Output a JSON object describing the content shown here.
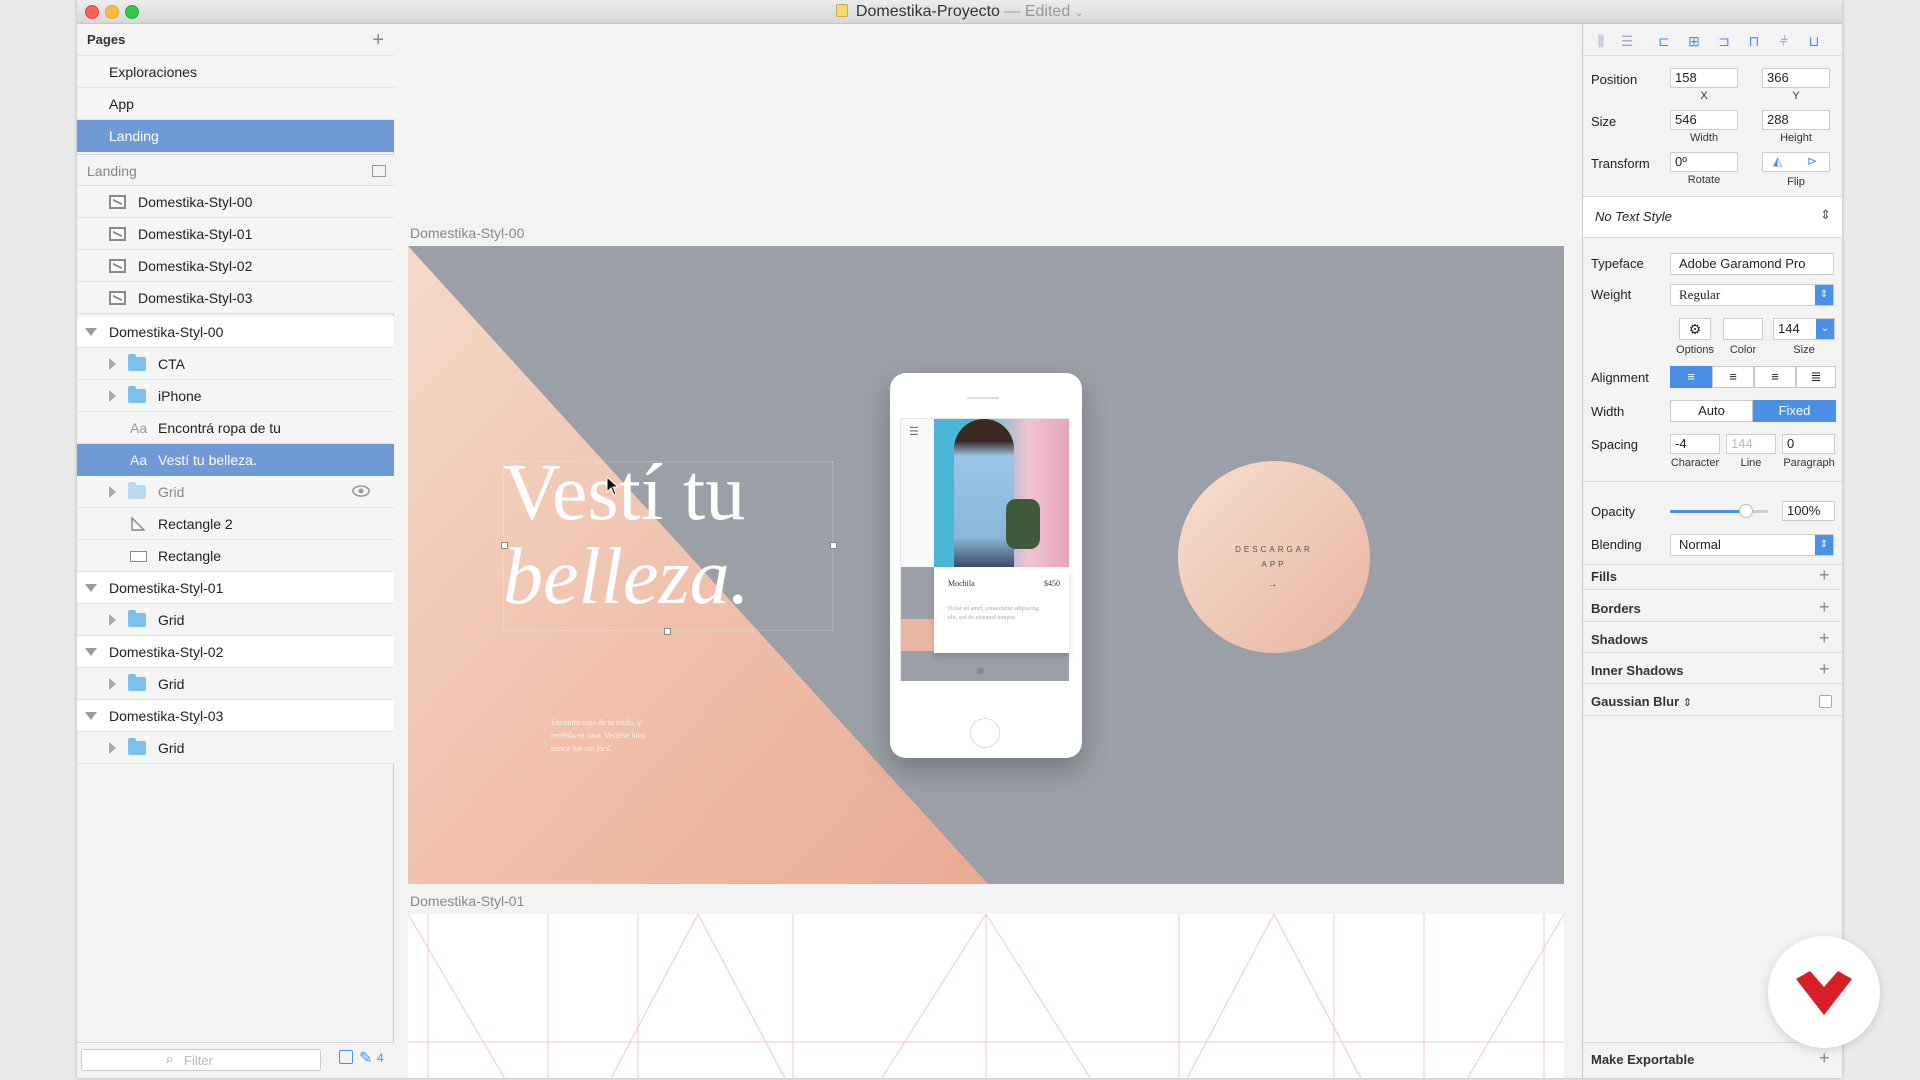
{
  "window": {
    "title": "Domestika-Proyecto",
    "title_separator": "—",
    "status": "Edited"
  },
  "pages": {
    "header": "Pages",
    "items": [
      "Exploraciones",
      "App",
      "Landing"
    ],
    "selected": "Landing"
  },
  "layers": {
    "header": "Landing",
    "artboards": [
      "Domestika-Styl-00",
      "Domestika-Styl-01",
      "Domestika-Styl-02",
      "Domestika-Styl-03"
    ],
    "tree": [
      {
        "label": "Domestika-Styl-00",
        "kind": "group"
      },
      {
        "label": "CTA",
        "kind": "folder"
      },
      {
        "label": "iPhone",
        "kind": "folder"
      },
      {
        "label": "Encontrá ropa de tu",
        "kind": "text",
        "icon_text": "Aa"
      },
      {
        "label": "Vestí tu belleza.",
        "kind": "text",
        "icon_text": "Aa",
        "selected": true
      },
      {
        "label": "Grid",
        "kind": "folder",
        "hidden": true
      },
      {
        "label": "Rectangle 2",
        "kind": "shape"
      },
      {
        "label": "Rectangle",
        "kind": "shape"
      },
      {
        "label": "Domestika-Styl-01",
        "kind": "group"
      },
      {
        "label": "Grid",
        "kind": "folder"
      },
      {
        "label": "Domestika-Styl-02",
        "kind": "group"
      },
      {
        "label": "Grid",
        "kind": "folder"
      },
      {
        "label": "Domestika-Styl-03",
        "kind": "group"
      },
      {
        "label": "Grid",
        "kind": "folder"
      }
    ],
    "filter_placeholder": "Filter",
    "footer_count": "4"
  },
  "canvas": {
    "artboard0_label": "Domestika-Styl-00",
    "artboard1_label": "Domestika-Styl-01",
    "headline_line1": "Vestí tu",
    "headline_line2": "belleza.",
    "body_text": "Encontrá ropa de tu estilo, y recibila en casa. Vestirse bien nunca fue tan fácil.",
    "phone": {
      "product_name": "Mochila",
      "product_price": "$450",
      "product_desc": "Dolor sit amet, consectetur adipiscing elit, sed do eiusmod tempor."
    },
    "cta_line1": "DESCARGAR",
    "cta_line2": "APP",
    "cta_arrow": "→"
  },
  "inspector": {
    "position_label": "Position",
    "x": "158",
    "y": "366",
    "x_label": "X",
    "y_label": "Y",
    "size_label": "Size",
    "width": "546",
    "height": "288",
    "width_label": "Width",
    "height_label": "Height",
    "transform_label": "Transform",
    "rotate": "0º",
    "rotate_label": "Rotate",
    "flip_label": "Flip",
    "text_style": "No Text Style",
    "typeface_label": "Typeface",
    "typeface": "Adobe Garamond Pro",
    "weight_label": "Weight",
    "weight": "Regular",
    "options_label": "Options",
    "color_label": "Color",
    "size_value": "144",
    "size_sub_label": "Size",
    "alignment_label": "Alignment",
    "width_mode_label": "Width",
    "width_auto": "Auto",
    "width_fixed": "Fixed",
    "spacing_label": "Spacing",
    "character": "-4",
    "line": "144",
    "paragraph": "0",
    "character_label": "Character",
    "line_label": "Line",
    "paragraph_label": "Paragraph",
    "opacity_label": "Opacity",
    "opacity": "100%",
    "opacity_fraction": 1.0,
    "blending_label": "Blending",
    "blending": "Normal",
    "sections": [
      "Fills",
      "Borders",
      "Shadows",
      "Inner Shadows"
    ],
    "gaussian_blur": "Gaussian Blur",
    "make_exportable": "Make Exportable"
  },
  "colors": {
    "selection": "#6f9ad6",
    "accent": "#4a90e6",
    "artboard_bg": "#9ba0a8",
    "peach": "#f0c4ad",
    "brand_red": "#d81f26"
  }
}
